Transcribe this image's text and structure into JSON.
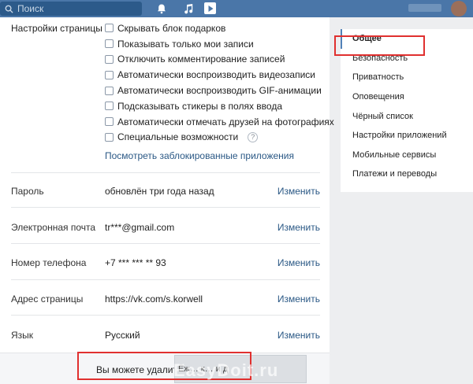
{
  "topbar": {
    "search_placeholder": "Поиск",
    "icons": [
      "search-icon",
      "bell-icon",
      "music-icon",
      "video-icon"
    ]
  },
  "page_settings": {
    "label": "Настройки страницы",
    "options": [
      {
        "label": "Скрывать блок подарков",
        "checked": false
      },
      {
        "label": "Показывать только мои записи",
        "checked": false
      },
      {
        "label": "Отключить комментирование записей",
        "checked": false
      },
      {
        "label": "Автоматически воспроизводить видеозаписи",
        "checked": false
      },
      {
        "label": "Автоматически воспроизводить GIF-анимации",
        "checked": false
      },
      {
        "label": "Подсказывать стикеры в полях ввода",
        "checked": false
      },
      {
        "label": "Автоматически отмечать друзей на фотографиях",
        "checked": false
      },
      {
        "label": "Специальные возможности",
        "checked": false
      }
    ],
    "help_glyph": "?",
    "blocked_apps_link": "Посмотреть заблокированные приложения"
  },
  "rows": [
    {
      "label": "Пароль",
      "value": "обновлён три года назад",
      "action": "Изменить"
    },
    {
      "label": "Электронная почта",
      "value": "tr***@gmail.com",
      "action": "Изменить"
    },
    {
      "label": "Номер телефона",
      "value": "+7 *** *** ** 93",
      "action": "Изменить"
    },
    {
      "label": "Адрес страницы",
      "value": "https://vk.com/s.korwell",
      "action": "Изменить"
    },
    {
      "label": "Язык",
      "value": "Русский",
      "action": "Изменить"
    }
  ],
  "footer": {
    "text": "Вы можете удалить",
    "blurred_text": "Ёж… к… и д"
  },
  "menu": {
    "items": [
      {
        "label": "Общее",
        "active": true
      },
      {
        "label": "Безопасность",
        "active": false
      },
      {
        "label": "Приватность",
        "active": false
      },
      {
        "label": "Оповещения",
        "active": false
      },
      {
        "label": "Чёрный список",
        "active": false
      },
      {
        "label": "Настройки приложений",
        "active": false
      },
      {
        "label": "Мобильные сервисы",
        "active": false
      },
      {
        "label": "Платежи и переводы",
        "active": false
      }
    ]
  },
  "watermark": "EasyDoit.ru",
  "colors": {
    "topbar": "#4a76a8",
    "link": "#2a5885",
    "highlight": "#e0302f",
    "background": "#edeef0"
  }
}
